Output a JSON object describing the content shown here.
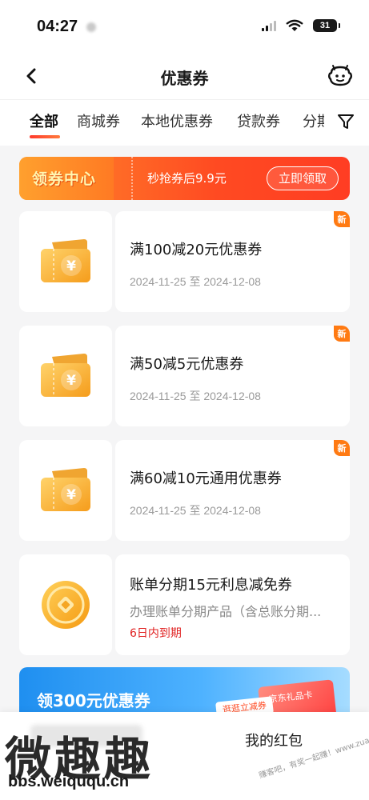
{
  "status_bar": {
    "time": "04:27",
    "battery": "31"
  },
  "nav": {
    "title": "优惠券"
  },
  "tabs": [
    {
      "label": "全部",
      "active": true
    },
    {
      "label": "商城券",
      "active": false
    },
    {
      "label": "本地优惠券",
      "active": false
    },
    {
      "label": "贷款券",
      "active": false
    },
    {
      "label": "分期",
      "active": false
    }
  ],
  "center_banner": {
    "title": "领券中心",
    "subtitle": "秒抢券后9.9元",
    "button": "立即领取"
  },
  "coupons": [
    {
      "title": "满100减20元优惠券",
      "date": "2024-11-25 至 2024-12-08",
      "badge": "新",
      "icon": "ticket-icon"
    },
    {
      "title": "满50减5元优惠券",
      "date": "2024-11-25 至 2024-12-08",
      "badge": "新",
      "icon": "ticket-icon"
    },
    {
      "title": "满60减10元通用优惠券",
      "date": "2024-11-25 至 2024-12-08",
      "badge": "新",
      "icon": "ticket-icon"
    },
    {
      "title": "账单分期15元利息减免券",
      "desc": "办理账单分期产品（含总账分期...",
      "expire": "6日内到期",
      "icon": "coin-icon"
    }
  ],
  "promo": {
    "title": "领300元优惠券",
    "tag": "逛逛立减券",
    "card_label": "京东礼品卡"
  },
  "bottom": {
    "red_packet": "我的红包"
  },
  "watermark": {
    "text": "微趣趣",
    "url": "bbs.weiququ.cn",
    "right_text": "赚客吧，有奖一起赚！www.zuanke8.com"
  },
  "colors": {
    "accent": "#ff3a2c",
    "orange": "#ff7a12",
    "gold": "#f5a623",
    "danger": "#e02020"
  }
}
